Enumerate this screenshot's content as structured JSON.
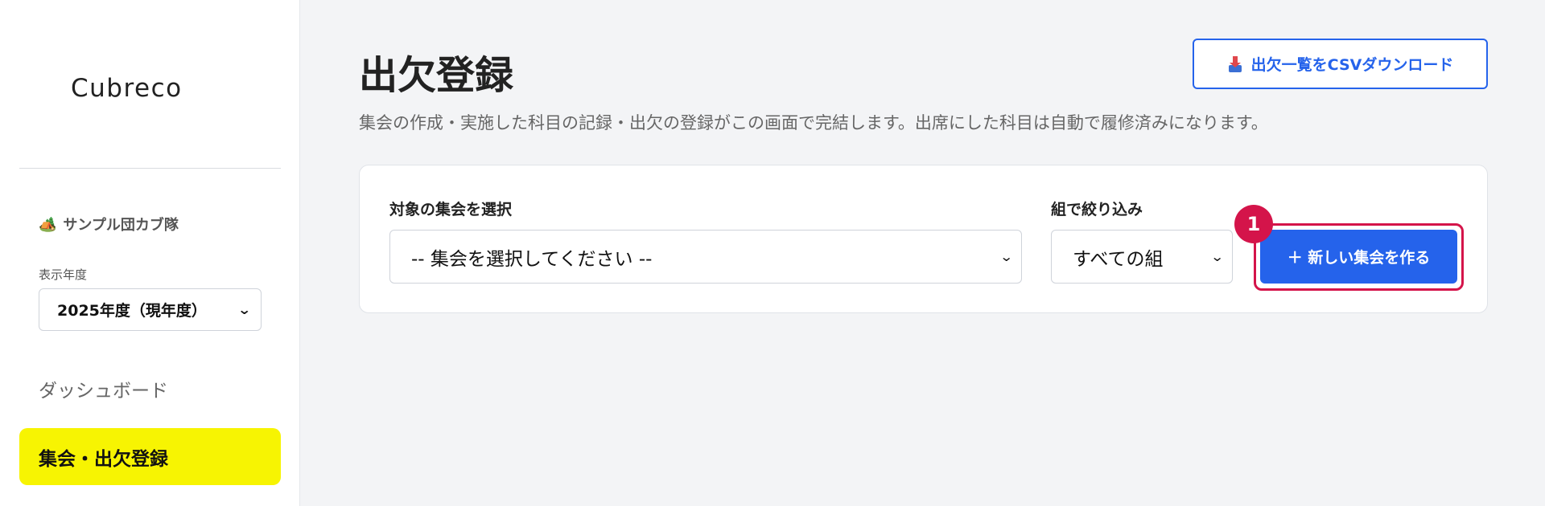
{
  "sidebar": {
    "logo": "Cubreco",
    "group": {
      "icon": "🏕️",
      "name": "サンプル団カブ隊"
    },
    "year_label": "表示年度",
    "year_select": {
      "value": "2025年度（現年度）"
    },
    "nav": [
      {
        "label": "ダッシュボード",
        "active": false
      },
      {
        "label": "集会・出欠登録",
        "active": true
      }
    ]
  },
  "header": {
    "title": "出欠登録",
    "description": "集会の作成・実施した科目の記録・出欠の登録がこの画面で完結します。出席にした科目は自動で履修済みになります。",
    "csv_button": {
      "icon": "download-tray-icon",
      "label": "出欠一覧をCSVダウンロード"
    }
  },
  "filters": {
    "meeting": {
      "label": "対象の集会を選択",
      "value": "-- 集会を選択してください --"
    },
    "group": {
      "label": "組で絞り込み",
      "value": "すべての組"
    },
    "new_button": {
      "label": "＋ 新しい集会を作る"
    },
    "step_badge": "1"
  },
  "colors": {
    "accent": "#2563eb",
    "active_nav": "#f7f402",
    "highlight": "#d4144a",
    "background": "#f3f4f6"
  }
}
